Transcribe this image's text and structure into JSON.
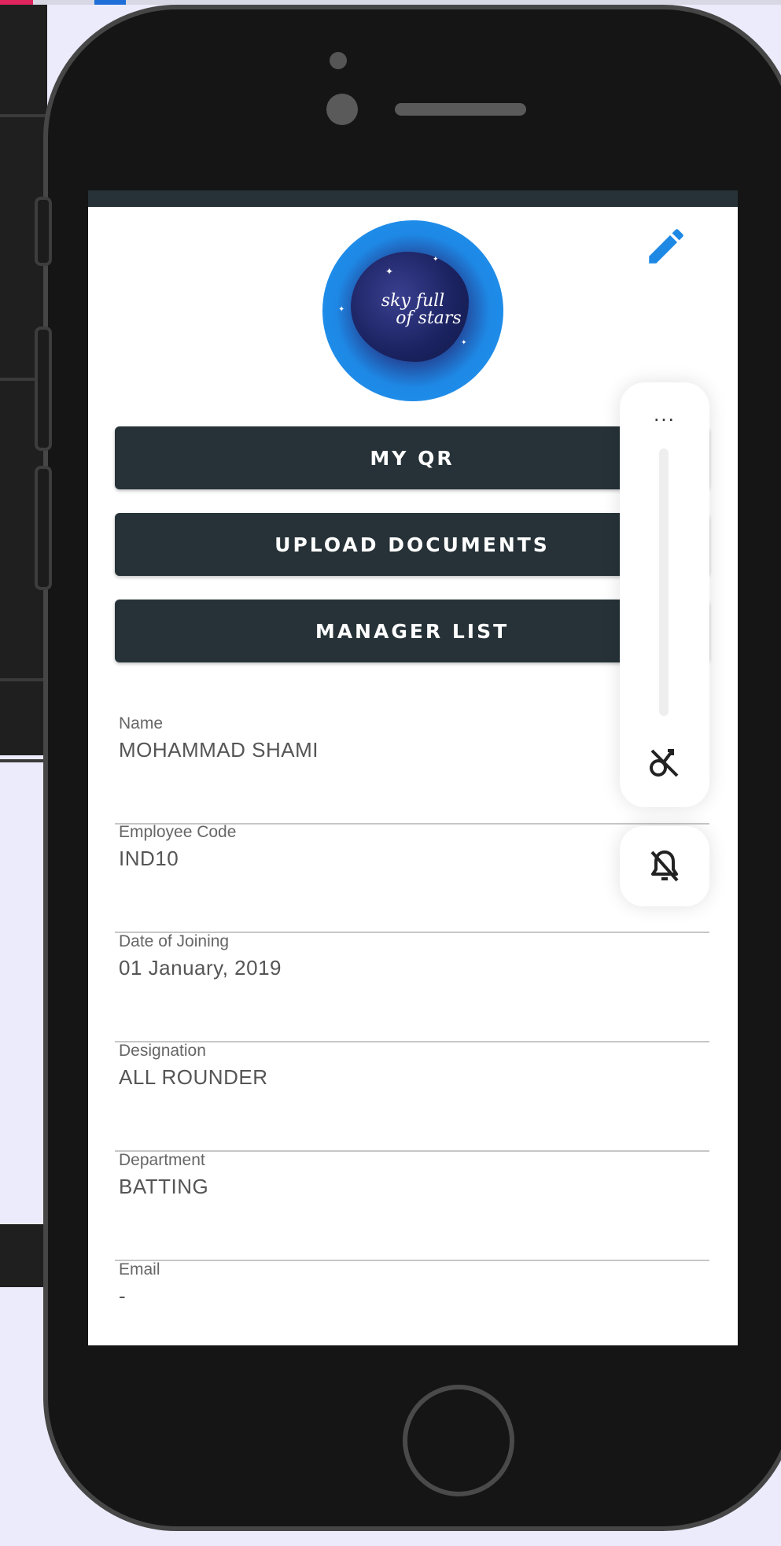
{
  "profile": {
    "avatar_text_line1": "sky full",
    "avatar_text_line2": "of stars"
  },
  "buttons": {
    "my_qr": "MY QR",
    "upload_documents": "UPLOAD DOCUMENTS",
    "manager_list": "MANAGER LIST"
  },
  "fields": [
    {
      "label": "Name",
      "value": "MOHAMMAD SHAMI"
    },
    {
      "label": "Employee Code",
      "value": "IND10"
    },
    {
      "label": "Date of Joining",
      "value": "01 January, 2019"
    },
    {
      "label": "Designation",
      "value": "ALL ROUNDER"
    },
    {
      "label": "Department",
      "value": "BATTING"
    },
    {
      "label": "Email",
      "value": "-"
    }
  ],
  "floating_tools": {
    "more_label": "...",
    "icons": [
      "rotate-off-icon",
      "bell-off-icon"
    ]
  },
  "icons": {
    "edit": "pencil-icon"
  },
  "colors": {
    "primary_dark": "#263238",
    "accent_blue": "#1e88e5",
    "background": "#ecebfb"
  }
}
